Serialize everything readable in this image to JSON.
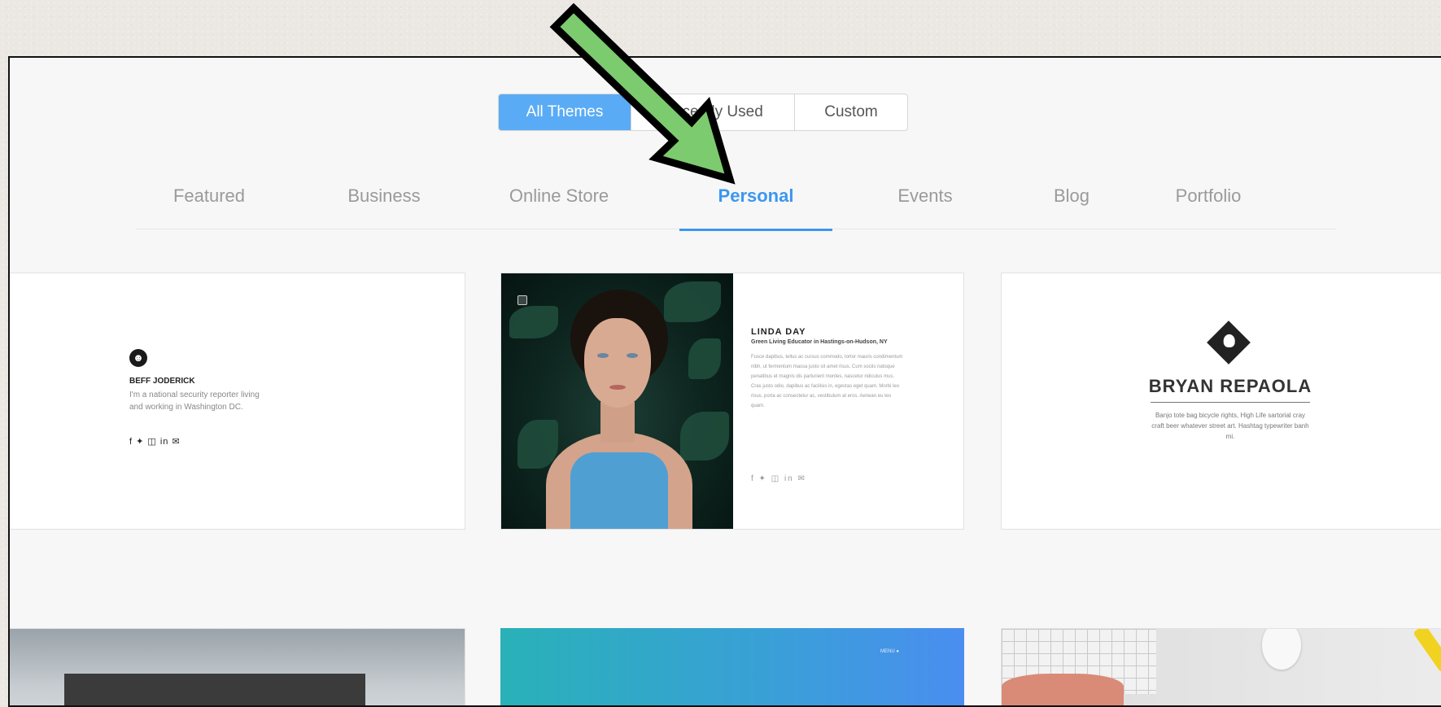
{
  "segmented": {
    "items": [
      {
        "label": "All Themes",
        "active": true
      },
      {
        "label": "Recently Used",
        "active": false
      },
      {
        "label": "Custom",
        "active": false
      }
    ]
  },
  "tabs": [
    {
      "label": "Featured",
      "active": false
    },
    {
      "label": "Business",
      "active": false
    },
    {
      "label": "Online Store",
      "active": false
    },
    {
      "label": "Personal",
      "active": true
    },
    {
      "label": "Events",
      "active": false
    },
    {
      "label": "Blog",
      "active": false
    },
    {
      "label": "Portfolio",
      "active": false
    }
  ],
  "cards": {
    "jeff": {
      "name": "BEFF JODERICK",
      "bio": "I'm a national security reporter living and working in Washington DC.",
      "social": "f ✦ ◫ in ✉"
    },
    "linda": {
      "name": "LINDA DAY",
      "subtitle": "Green Living Educator in Hastings-on-Hudson, NY",
      "body": "Fusce dapibus, tellus ac cursus commodo, tortor mauris condimentum nibh, ut fermentum massa justo sit amet risus. Cum sociis natoque penatibus et magnis dis parturient montes, nascetur ridiculus mus. Cras justo odio, dapibus ac facilisis in, egestas eget quam. Morbi leo risus, porta ac consectetur ac, vestibulum at eros. Aenean eu leo quam.",
      "social": "f ✦ ◫ in ✉"
    },
    "bryan": {
      "name": "BRYAN REPAOLA",
      "body": "Banjo tote bag bicycle rights, High Life sartorial cray craft beer whatever street art. Hashtag typewriter banh mi."
    },
    "gradient": {
      "menu": "MENU ●"
    }
  },
  "colors": {
    "accent": "#3b97ef",
    "segment_active": "#5aabf5",
    "annotation_arrow": "#7ccb6e"
  },
  "icons": {
    "annotation": "arrow-icon"
  }
}
